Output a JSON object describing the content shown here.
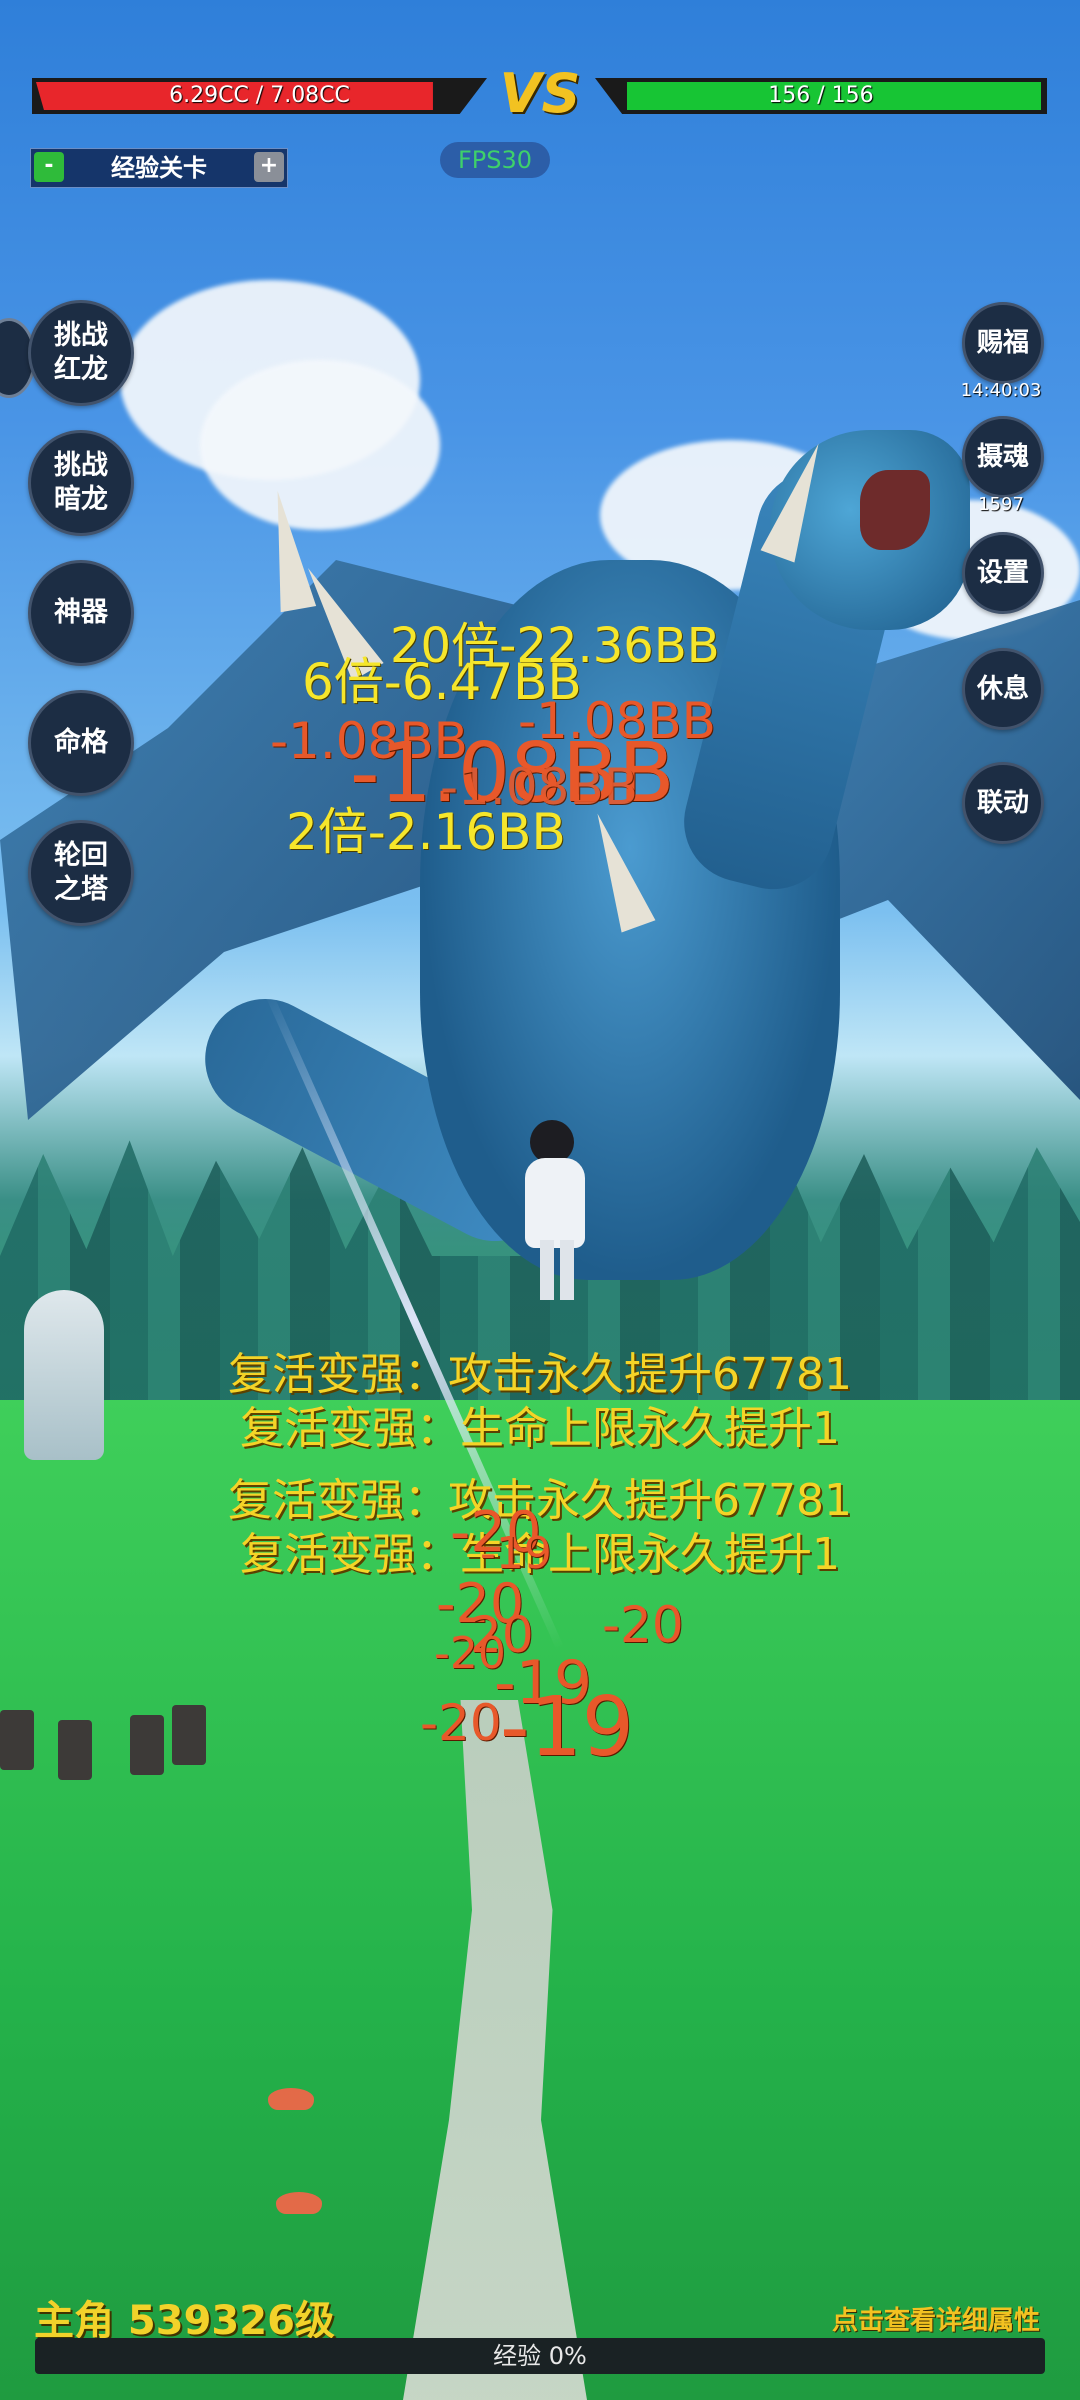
{
  "hud": {
    "player_hp": "6.29CC / 7.08CC",
    "player_hp_fraction": 0.89,
    "vs": "VS",
    "enemy_hp": "156 / 156",
    "enemy_hp_fraction": 1.0,
    "mode_minus": "-",
    "mode_label": "经验关卡",
    "mode_plus": "+",
    "fps": "FPS30"
  },
  "left_menu": [
    {
      "label": "挑战\n红龙"
    },
    {
      "label": "挑战\n暗龙"
    },
    {
      "label": "神器"
    },
    {
      "label": "命格"
    },
    {
      "label": "轮回\n之塔"
    }
  ],
  "right_menu": [
    {
      "label": "赐福",
      "sub": "14:40:03"
    },
    {
      "label": "摄魂",
      "sub": "1597"
    },
    {
      "label": "设置"
    },
    {
      "label": "休息"
    },
    {
      "label": "联动"
    }
  ],
  "combat_text": {
    "t1": "20倍-22.36BB",
    "t2": "6倍-6.47BB",
    "t3": "-1.08BB",
    "t4": "-1.08BB",
    "t5": "-1.08BB",
    "t6": "-1.08BB",
    "t7": "2倍-2.16BB",
    "buff1": "复活变强：攻击永久提升67781",
    "buff2": "复活变强：生命上限永久提升1",
    "buff3": "复活变强：攻击永久提升67781",
    "buff4": "复活变强：生命上限永久提升1",
    "n1": "-20",
    "n2": "-19",
    "n3": "-20",
    "n4": "-20",
    "n5": "-20",
    "n6": "-20",
    "n7": "-19",
    "n8": "-20",
    "n9": "-19"
  },
  "footer": {
    "level": "主角 539326级",
    "detail_link": "点击查看详细属性",
    "exp": "经验 0%",
    "exp_fraction": 0.0
  }
}
